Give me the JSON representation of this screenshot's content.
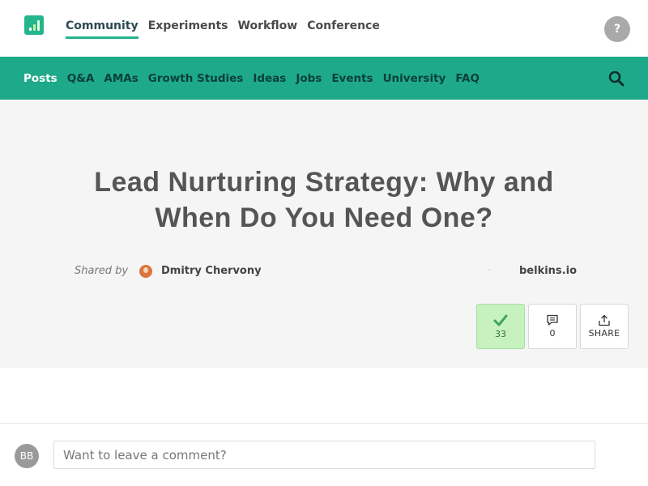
{
  "top_nav": {
    "items": [
      {
        "label": "Community",
        "active": true
      },
      {
        "label": "Experiments"
      },
      {
        "label": "Workflow"
      },
      {
        "label": "Conference"
      }
    ],
    "help_label": "?"
  },
  "sub_nav": {
    "links": [
      {
        "label": "Posts",
        "active": true
      },
      {
        "label": "Q&A"
      },
      {
        "label": "AMAs"
      },
      {
        "label": "Growth Studies"
      },
      {
        "label": "Ideas"
      },
      {
        "label": "Jobs"
      },
      {
        "label": "Events"
      },
      {
        "label": "University"
      },
      {
        "label": "FAQ"
      }
    ]
  },
  "post": {
    "title": "Lead Nurturing Strategy: Why and When Do You Need One?",
    "shared_by_label": "Shared by",
    "author": "Dmitry Chervony",
    "separator": "·",
    "source": "belkins.io",
    "upvotes": "33",
    "comments": "0",
    "share_label": "SHARE"
  },
  "comment_box": {
    "avatar_initials": "BB",
    "placeholder": "Want to leave a comment?"
  },
  "colors": {
    "brand_green": "#1eaa8a",
    "vote_bg": "#c7f2c0",
    "check_green": "#3fa55a"
  }
}
